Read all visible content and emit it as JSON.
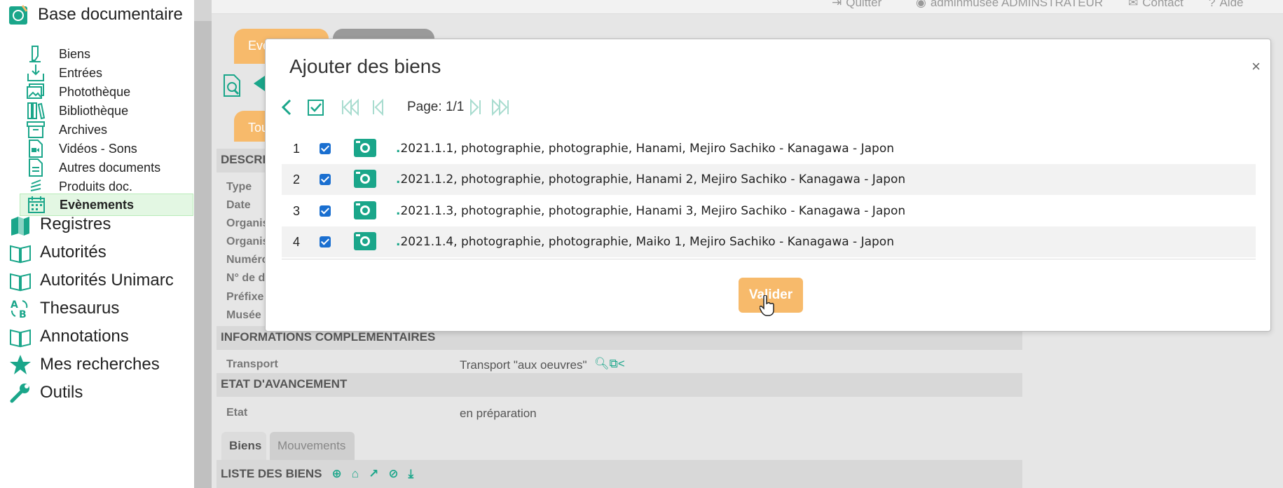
{
  "sidebar": {
    "title": "Base documentaire",
    "sub_items": [
      {
        "label": "Biens",
        "icon": "hand-icon"
      },
      {
        "label": "Entrées",
        "icon": "inbox-icon"
      },
      {
        "label": "Photothèque",
        "icon": "images-icon"
      },
      {
        "label": "Bibliothèque",
        "icon": "books-icon"
      },
      {
        "label": "Archives",
        "icon": "archive-icon"
      },
      {
        "label": "Vidéos - Sons",
        "icon": "video-file-icon"
      },
      {
        "label": "Autres documents",
        "icon": "document-icon"
      },
      {
        "label": "Produits doc.",
        "icon": "stack-icon"
      },
      {
        "label": "Evènements",
        "icon": "calendar-icon",
        "active": true
      }
    ],
    "main_items": [
      {
        "label": "Registres",
        "icon": "registers-icon"
      },
      {
        "label": "Autorités",
        "icon": "book-open-icon"
      },
      {
        "label": "Autorités Unimarc",
        "icon": "book-open-icon"
      },
      {
        "label": "Thesaurus",
        "icon": "thesaurus-icon"
      },
      {
        "label": "Annotations",
        "icon": "book-open-icon"
      },
      {
        "label": "Mes recherches",
        "icon": "star-icon"
      },
      {
        "label": "Outils",
        "icon": "wrench-icon"
      }
    ]
  },
  "topbar": {
    "quit": "Quitter",
    "user": "adminmusee ADMINSTRATEUR",
    "contact": "Contact",
    "help": "Aide"
  },
  "background": {
    "tab1": "Eve",
    "tab2": "",
    "tab_all": "Tou",
    "description_header": "DESCRI",
    "labels": [
      "Type",
      "Date",
      "Organis",
      "Organis",
      "Numéro",
      "N° de d",
      "Préfixe",
      "Musée"
    ],
    "info_header": "INFORMATIONS COMPLEMENTAIRES",
    "transport_label": "Transport",
    "transport_value": "Transport \"aux oeuvres\"",
    "state_header": "ETAT D'AVANCEMENT",
    "state_label": "Etat",
    "state_value": "en préparation",
    "tabs": [
      "Biens",
      "Mouvements"
    ],
    "list_header": "LISTE DES BIENS"
  },
  "modal": {
    "title": "Ajouter des biens",
    "close": "×",
    "page_label": "Page:",
    "page_value": "1/1",
    "rows": [
      {
        "num": "1",
        "prefix": ".",
        "text": "2021.1.1, photographie, photographie, Hanami, Mejiro Sachiko - Kanagawa - Japon",
        "checked": true
      },
      {
        "num": "2",
        "prefix": ".",
        "text": "2021.1.2, photographie, photographie, Hanami 2, Mejiro Sachiko - Kanagawa - Japon",
        "checked": true
      },
      {
        "num": "3",
        "prefix": ".",
        "text": "2021.1.3, photographie, photographie, Hanami 3, Mejiro Sachiko - Kanagawa - Japon",
        "checked": true
      },
      {
        "num": "4",
        "prefix": ".",
        "text": "2021.1.4, photographie, photographie, Maiko 1, Mejiro Sachiko - Kanagawa - Japon",
        "checked": true
      }
    ],
    "validate": "Valider"
  },
  "colors": {
    "accent": "#1aa68a",
    "orange": "#f7ba6b",
    "active_bg": "#e3f7e3"
  }
}
